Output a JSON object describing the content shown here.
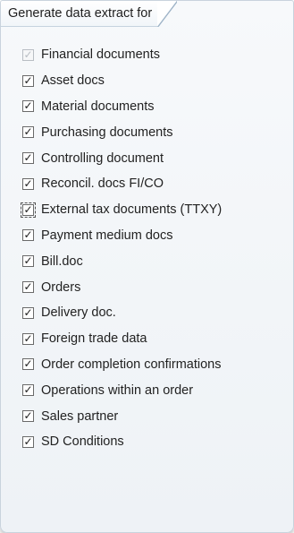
{
  "group": {
    "title": "Generate data extract for"
  },
  "check_glyph": "✓",
  "items": [
    {
      "label": "Financial documents",
      "checked": true,
      "disabled": true
    },
    {
      "label": "Asset docs",
      "checked": true
    },
    {
      "label": "Material documents",
      "checked": true
    },
    {
      "label": "Purchasing documents",
      "checked": true
    },
    {
      "label": "Controlling document",
      "checked": true
    },
    {
      "label": "Reconcil. docs FI/CO",
      "checked": true
    },
    {
      "label": "External tax documents (TTXY)",
      "checked": true,
      "focused": true
    },
    {
      "label": "Payment medium docs",
      "checked": true
    },
    {
      "label": "Bill.doc",
      "checked": true
    },
    {
      "label": "Orders",
      "checked": true
    },
    {
      "label": "Delivery doc.",
      "checked": true
    },
    {
      "label": "Foreign trade data",
      "checked": true
    },
    {
      "label": "Order completion confirmations",
      "checked": true
    },
    {
      "label": "Operations within an order",
      "checked": true
    },
    {
      "label": "Sales partner",
      "checked": true
    },
    {
      "label": "SD Conditions",
      "checked": true
    }
  ]
}
